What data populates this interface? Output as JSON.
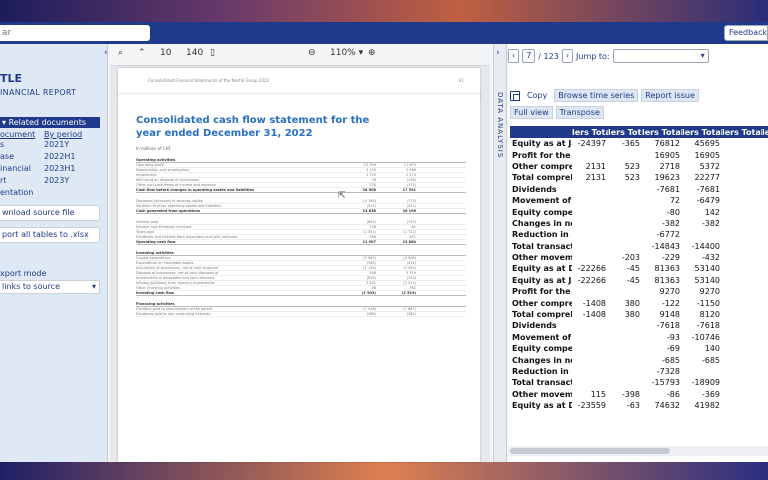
{
  "topbar": {
    "search_text": "ar",
    "feedback_label": "Feedback"
  },
  "sidebar": {
    "title": "TLE",
    "subtitle": "INANCIAL REPORT",
    "section_header": "Related documents",
    "col_headers": [
      "ocument",
      "By period"
    ],
    "rows": [
      {
        "left": "s",
        "right": "2021Y"
      },
      {
        "left": "ase",
        "right": "2022H1"
      },
      {
        "left": "inancial",
        "right": "2023H1"
      },
      {
        "left": "rt",
        "right": "2023Y"
      },
      {
        "left": "entation",
        "right": ""
      }
    ],
    "download_label": "wnload source file",
    "export_label": "port all tables to .xlsx",
    "export_mode_label": "xport mode",
    "export_mode_value": "links to source"
  },
  "viewer": {
    "page_current": "10",
    "page_total": "140",
    "zoom": "110%",
    "page_header": "Consolidated Financial Statements of the Nestlé Group 2022",
    "page_number": "91",
    "doc_title": "Consolidated cash flow statement for the year ended December 31, 2022",
    "doc_sub": "In millions of CHF",
    "table_lines": [
      {
        "a": "Operating activities",
        "n1": "",
        "n2": "",
        "bold": true
      },
      {
        "a": "Operating profit",
        "n1": "13 299",
        "n2": "11 675"
      },
      {
        "a": "Depreciation and amortization",
        "n1": "3 145",
        "n2": "2 966"
      },
      {
        "a": "Impairment",
        "n1": "1 720",
        "n2": "2 474"
      },
      {
        "a": "Net result on disposal of businesses",
        "n1": "76",
        "n2": "(138)"
      },
      {
        "a": "Other non-cash items of income and expense",
        "n1": "278",
        "n2": "(172)"
      },
      {
        "a": "Cash flow before changes in operating assets and liabilities",
        "n1": "18 508",
        "n2": "17 391",
        "bold": true
      },
      {
        "a": "",
        "n1": "",
        "n2": "",
        "gap": true
      },
      {
        "a": "Decrease/(increase) in working capital",
        "n1": "(4 156)",
        "n2": "(773)"
      },
      {
        "a": "Variation of other operating assets and liabilities",
        "n1": "(514)",
        "n2": "(422)"
      },
      {
        "a": "Cash generated from operations",
        "n1": "13 838",
        "n2": "16 196",
        "bold": true
      },
      {
        "a": "",
        "n1": "",
        "n2": "",
        "gap": true
      },
      {
        "a": "Interest paid",
        "n1": "(853)",
        "n2": "(723)"
      },
      {
        "a": "Interest and dividends received",
        "n1": "138",
        "n2": "82"
      },
      {
        "a": "Taxes paid",
        "n1": "(2 501)",
        "n2": "(2 722)"
      },
      {
        "a": "Dividends and interest from associates and joint ventures",
        "n1": "998",
        "n2": "871"
      },
      {
        "a": "Operating cash flow",
        "n1": "11 907",
        "n2": "13 864",
        "bold": true
      },
      {
        "a": "",
        "n1": "",
        "n2": "",
        "gap": true
      },
      {
        "a": "Investing activities",
        "n1": "",
        "n2": "",
        "bold": true
      },
      {
        "a": "Capital expenditure",
        "n1": "(5 065)",
        "n2": "(4 908)"
      },
      {
        "a": "Expenditure on intangible assets",
        "n1": "(366)",
        "n2": "(414)"
      },
      {
        "a": "Acquisition of businesses, net of cash acquired",
        "n1": "(1 116)",
        "n2": "(5 354)"
      },
      {
        "a": "Disposal of businesses, net of cash disposed of",
        "n1": "188",
        "n2": "5 319"
      },
      {
        "a": "Investments in associates and joint ventures",
        "n1": "(819)",
        "n2": "(110)"
      },
      {
        "a": "Inflows/(outflows) from treasury investments",
        "n1": "3 401",
        "n2": "(3 515)"
      },
      {
        "a": "Other investing activities",
        "n1": "56",
        "n2": "392"
      },
      {
        "a": "Investing cash flow",
        "n1": "(1 903)",
        "n2": "(2 519)",
        "bold": true
      },
      {
        "a": "",
        "n1": "",
        "n2": "",
        "gap": true
      },
      {
        "a": "Financing activities",
        "n1": "",
        "n2": "",
        "bold": true
      },
      {
        "a": "Dividend paid to shareholders of the parent",
        "n1": "(7 518)",
        "n2": "(7 887)"
      },
      {
        "a": "Dividends paid to non-controlling interests",
        "n1": "(266)",
        "n2": "(362)"
      }
    ]
  },
  "divider_label": "DATA ANALYSIS",
  "data_panel": {
    "page_value": "7",
    "page_total": "/ 123",
    "jump_label": "Jump to:",
    "buttons": [
      "Copy",
      "Browse time series",
      "Report issue"
    ],
    "buttons2": [
      "Full view",
      "Transpose"
    ],
    "headers": [
      "",
      "lers Total",
      "lers Total",
      "lers Total",
      "lers Total",
      "lers Total",
      "lers"
    ],
    "rows": [
      [
        "Equity as at January 1, 2",
        "-24397",
        "-365",
        "76812",
        "45695",
        "",
        ""
      ],
      [
        "Profit for the year",
        "",
        "",
        "16905",
        "16905",
        "",
        ""
      ],
      [
        "Other comprehensive in",
        "2131",
        "523",
        "2718",
        "5372",
        "",
        ""
      ],
      [
        "Total comprehensive in",
        "2131",
        "523",
        "19623",
        "22277",
        "",
        ""
      ],
      [
        "Dividends",
        "",
        "",
        "-7681",
        "-7681",
        "",
        ""
      ],
      [
        "Movement of treasury s",
        "",
        "",
        "72",
        "-6479",
        "",
        ""
      ],
      [
        "Equity compensation pl",
        "",
        "",
        "-80",
        "142",
        "",
        ""
      ],
      [
        "Changes in non-control",
        "",
        "",
        "-382",
        "-382",
        "",
        ""
      ],
      [
        "Reduction in share capi",
        "",
        "",
        "-6772",
        "",
        "",
        ""
      ],
      [
        "Total transactions with",
        "",
        "",
        "-14843",
        "-14400",
        "",
        ""
      ],
      [
        "Other movements (c)",
        "",
        "-203",
        "-229",
        "-432",
        "",
        ""
      ],
      [
        "Equity as at December 3",
        "-22266",
        "-45",
        "81363",
        "53140",
        "",
        ""
      ],
      [
        "Equity as at January 1, 2",
        "-22266",
        "-45",
        "81363",
        "53140",
        "",
        ""
      ],
      [
        "Profit for the year",
        "",
        "",
        "9270",
        "9270",
        "",
        ""
      ],
      [
        "Other comprehensive in",
        "-1408",
        "380",
        "-122",
        "-1150",
        "",
        ""
      ],
      [
        "Total comprehensive in",
        "-1408",
        "380",
        "9148",
        "8120",
        "",
        ""
      ],
      [
        "Dividends",
        "",
        "",
        "-7618",
        "-7618",
        "",
        ""
      ],
      [
        "Movement of treasury s",
        "",
        "",
        "-93",
        "-10746",
        "",
        ""
      ],
      [
        "Equity compensation pl",
        "",
        "",
        "-69",
        "140",
        "",
        ""
      ],
      [
        "Changes in non-control",
        "",
        "",
        "-685",
        "-685",
        "",
        ""
      ],
      [
        "Reduction in share capi",
        "",
        "",
        "-7328",
        "",
        "",
        ""
      ],
      [
        "Total transactions with",
        "",
        "",
        "-15793",
        "-18909",
        "",
        ""
      ],
      [
        "Other movements (c)",
        "115",
        "-398",
        "-86",
        "-369",
        "",
        ""
      ],
      [
        "Equity as at December 3",
        "-23559",
        "-63",
        "74632",
        "41982",
        "",
        ""
      ]
    ]
  }
}
